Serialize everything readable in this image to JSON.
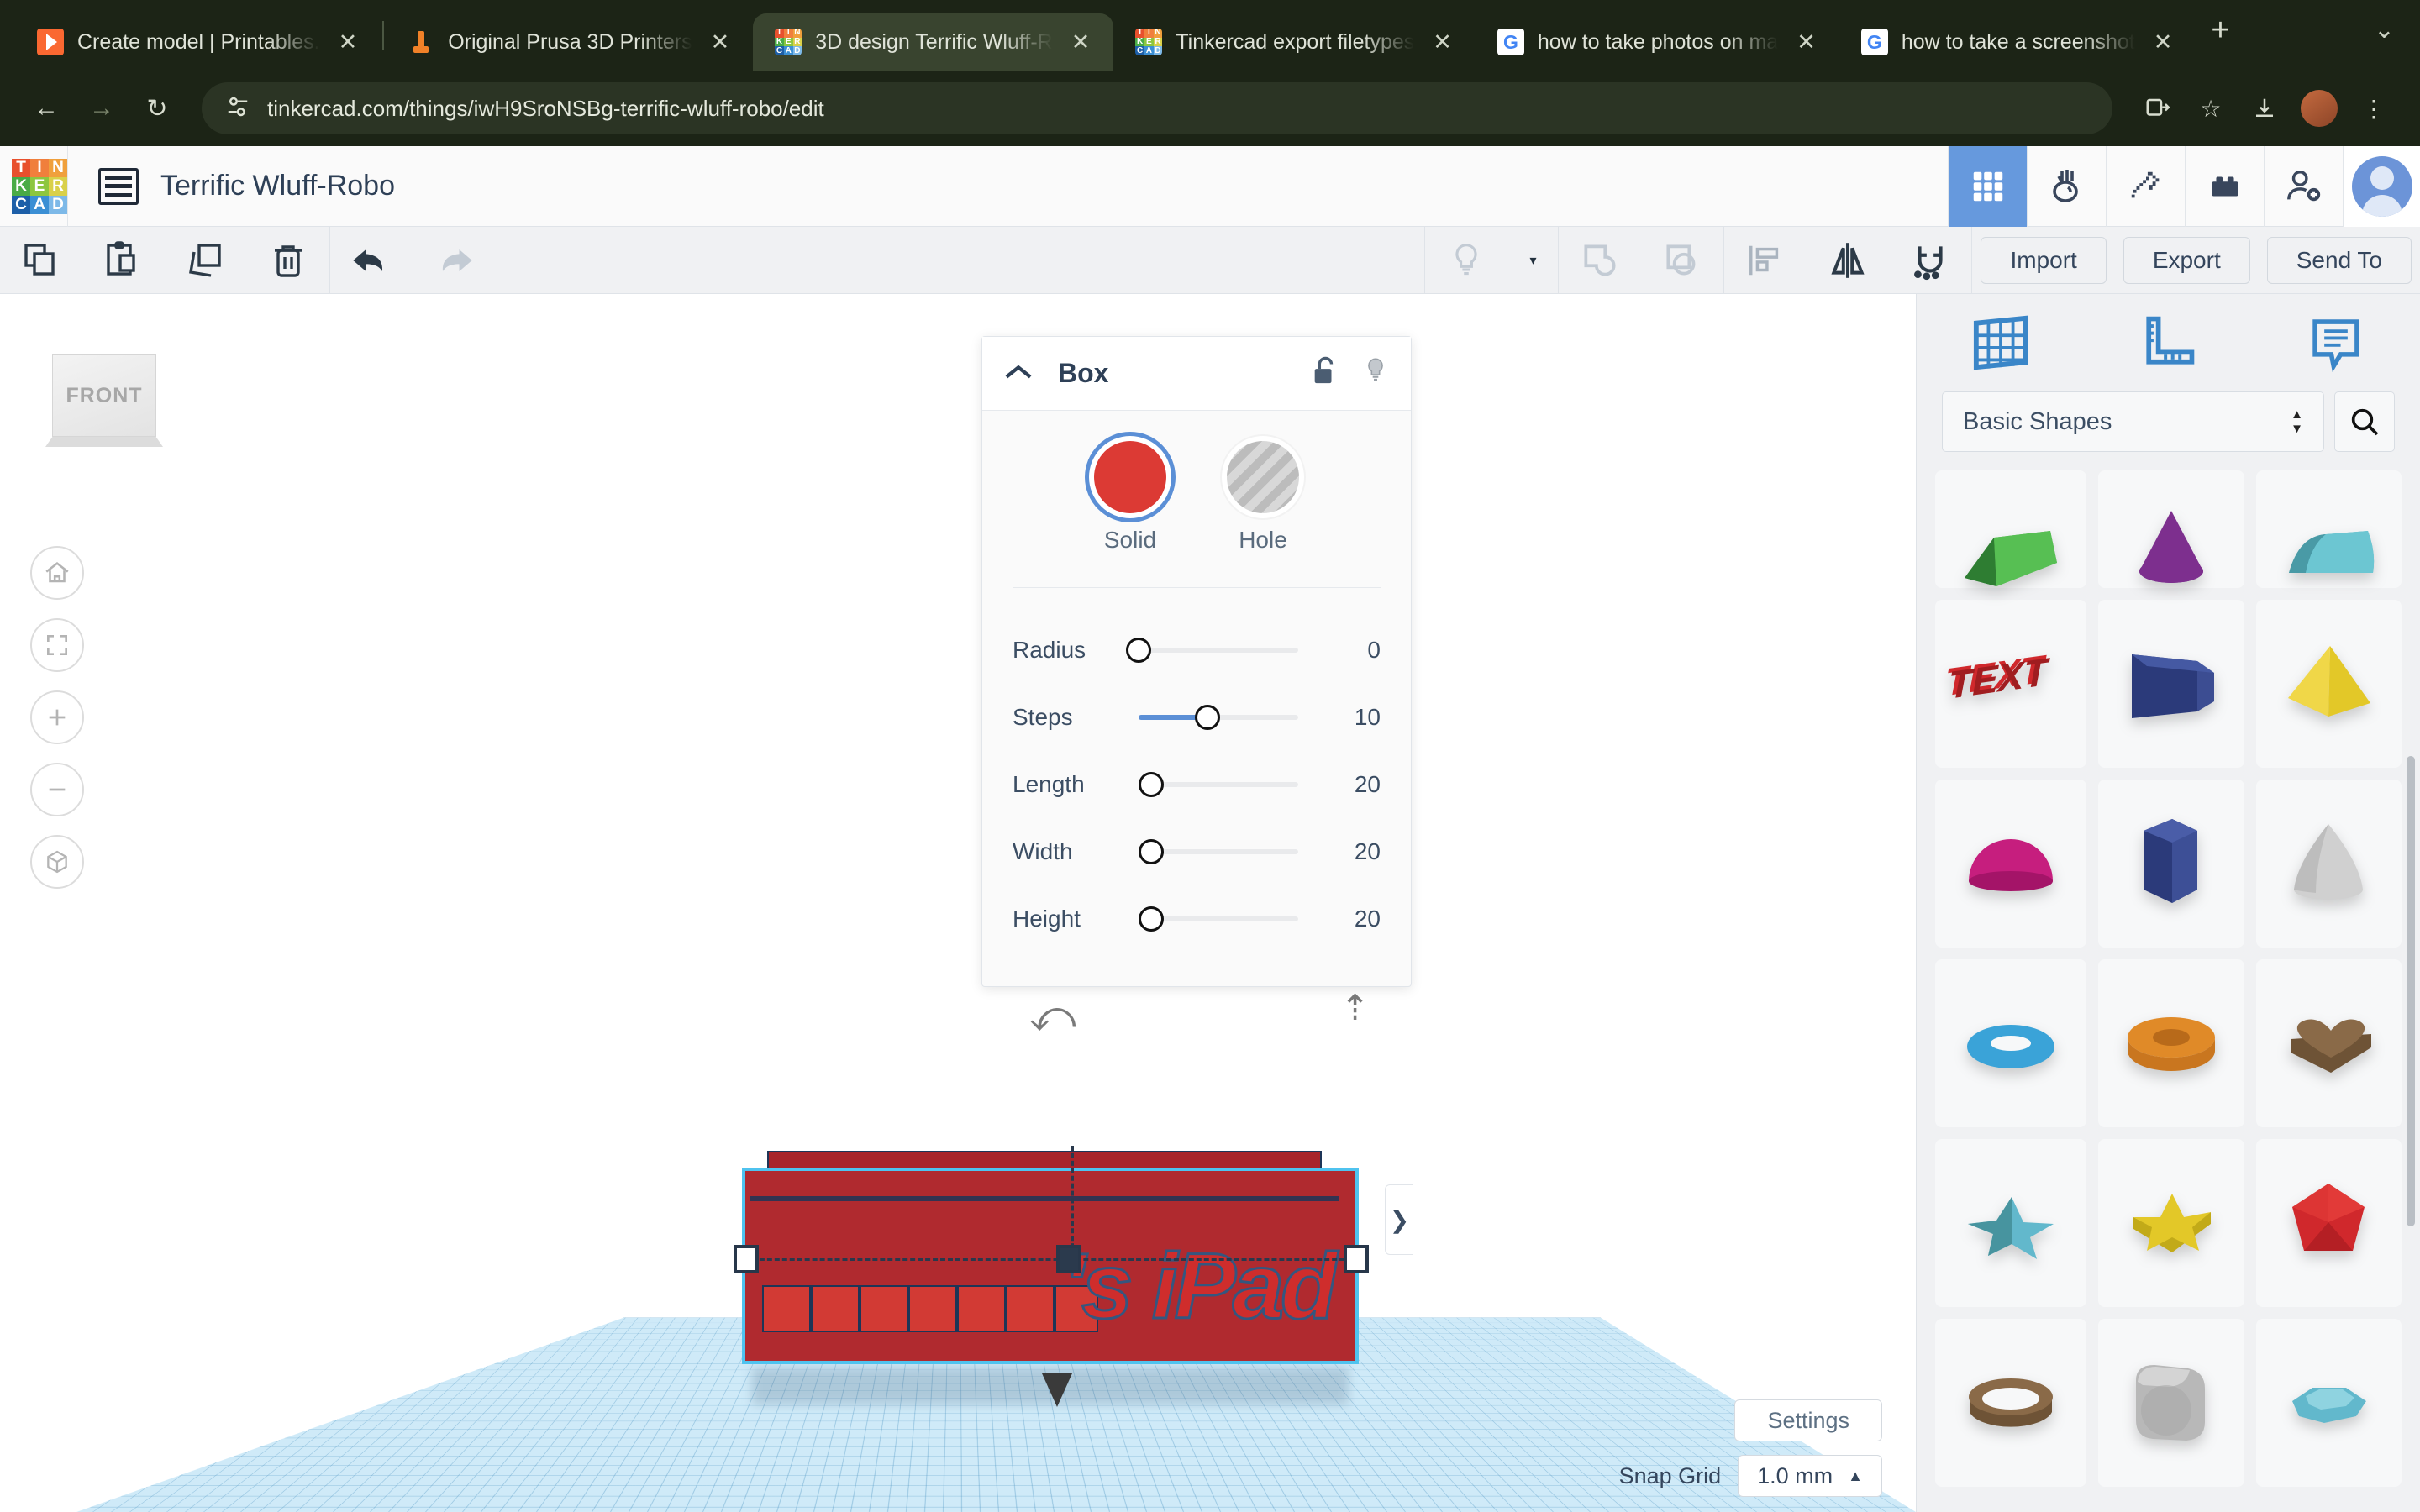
{
  "browser": {
    "tabs": [
      {
        "title": "Create model | Printables.",
        "favicon": "printables-icon",
        "active": false
      },
      {
        "title": "Original Prusa 3D Printers",
        "favicon": "prusa-icon",
        "active": false
      },
      {
        "title": "3D design Terrific Wluff-R",
        "favicon": "tinkercad-icon",
        "active": true
      },
      {
        "title": "Tinkercad export filetypes",
        "favicon": "tinkercad-icon",
        "active": false
      },
      {
        "title": "how to take photos on ma",
        "favicon": "google-icon",
        "active": false
      },
      {
        "title": "how to take a screenshot",
        "favicon": "google-icon",
        "active": false
      }
    ],
    "new_tab_label": "+",
    "tab_close_label": "✕",
    "tab_list_label": "⌄",
    "back_label": "←",
    "forward_label": "→",
    "reload_label": "↻",
    "url": "tinkercad.com/things/iwH9SroNSBg-terrific-wluff-robo/edit",
    "site_info_icon": "site-settings-icon",
    "install_icon": "install-app-icon",
    "bookmark_icon": "star-icon",
    "download_icon": "download-icon",
    "menu_icon": "kebab-menu-icon",
    "profile_icon": "profile-avatar-icon"
  },
  "tinkercad_logo": [
    "T",
    "I",
    "N",
    "K",
    "E",
    "R",
    "C",
    "A",
    "D"
  ],
  "header": {
    "menu_icon": "design-list-icon",
    "title": "Terrific Wluff-Robo",
    "tools": [
      {
        "name": "3d-designs-grid",
        "icon": "grid-icon",
        "active": true
      },
      {
        "name": "codeblocks",
        "icon": "codeblocks-hand-icon",
        "active": false
      },
      {
        "name": "minecraft",
        "icon": "pickaxe-icon",
        "active": false
      },
      {
        "name": "blocks",
        "icon": "lego-brick-icon",
        "active": false
      },
      {
        "name": "invite",
        "icon": "add-person-icon",
        "active": false
      }
    ],
    "avatar_icon": "user-avatar-icon"
  },
  "toolbar": {
    "left": [
      {
        "name": "copy",
        "icon": "copy-icon",
        "disabled": false
      },
      {
        "name": "paste",
        "icon": "paste-icon",
        "disabled": false
      },
      {
        "name": "duplicate",
        "icon": "duplicate-icon",
        "disabled": false
      },
      {
        "name": "delete",
        "icon": "trash-icon",
        "disabled": false
      }
    ],
    "history": [
      {
        "name": "undo",
        "icon": "undo-arrow-icon",
        "disabled": false
      },
      {
        "name": "redo",
        "icon": "redo-arrow-icon",
        "disabled": true
      }
    ],
    "right_icons": [
      {
        "name": "lightbulb",
        "icon": "lightbulb-icon",
        "disabled": true
      },
      {
        "name": "lightbulb-dropdown",
        "icon": "chevron-down-icon",
        "disabled": false
      },
      {
        "name": "group",
        "icon": "group-shapes-icon",
        "disabled": true
      },
      {
        "name": "ungroup",
        "icon": "ungroup-shapes-icon",
        "disabled": true
      },
      {
        "name": "align",
        "icon": "align-icon",
        "disabled": false
      },
      {
        "name": "mirror",
        "icon": "mirror-flip-icon",
        "disabled": false
      },
      {
        "name": "snap-magnet",
        "icon": "magnet-icon",
        "disabled": false
      }
    ],
    "import_label": "Import",
    "export_label": "Export",
    "send_to_label": "Send To"
  },
  "viewport": {
    "view_cube_label": "FRONT",
    "controls": [
      {
        "name": "home-view",
        "icon": "home-icon"
      },
      {
        "name": "fit-all",
        "icon": "fit-to-view-icon"
      },
      {
        "name": "zoom-in",
        "icon": "plus-icon"
      },
      {
        "name": "zoom-out",
        "icon": "minus-icon"
      },
      {
        "name": "ortho-toggle",
        "icon": "perspective-cube-icon"
      }
    ],
    "model_text": "'s iPad",
    "settings_label": "Settings",
    "snap_grid_label": "Snap Grid",
    "snap_grid_value": "1.0 mm",
    "snap_grid_caret": "▲"
  },
  "inspector": {
    "collapse_icon": "chevron-up-icon",
    "title": "Box",
    "lock_icon": "unlocked-padlock-icon",
    "light_icon": "lightbulb-icon",
    "modes": [
      {
        "label": "Solid",
        "color": "#dc3a34",
        "selected": true
      },
      {
        "label": "Hole",
        "color": "#bcbcbc",
        "selected": false
      }
    ],
    "sliders": [
      {
        "label": "Radius",
        "value": "0",
        "pct": 0
      },
      {
        "label": "Steps",
        "value": "10",
        "pct": 43
      },
      {
        "label": "Length",
        "value": "20",
        "pct": 8
      },
      {
        "label": "Width",
        "value": "20",
        "pct": 8
      },
      {
        "label": "Height",
        "value": "20",
        "pct": 8
      }
    ],
    "panel_toggle_icon": "chevron-right-icon"
  },
  "shapes_panel": {
    "tabs": [
      {
        "name": "workplane",
        "icon": "workplane-grid-icon"
      },
      {
        "name": "ruler",
        "icon": "ruler-icon"
      },
      {
        "name": "note",
        "icon": "note-callout-icon"
      }
    ],
    "category_value": "Basic Shapes",
    "search_icon": "search-icon",
    "shapes": [
      {
        "name": "roof",
        "icon": "roof-shape",
        "color": "#4aab46"
      },
      {
        "name": "cone",
        "icon": "cone-shape",
        "color": "#7d2f8e"
      },
      {
        "name": "half-cylinder",
        "icon": "half-cylinder-shape",
        "color": "#5bb8c4"
      },
      {
        "name": "text",
        "icon": "text-shape",
        "color": "#d0282c",
        "label": "TEXT"
      },
      {
        "name": "box",
        "icon": "box-shape",
        "color": "#2b3a7a"
      },
      {
        "name": "pyramid",
        "icon": "pyramid-shape",
        "color": "#e3c828"
      },
      {
        "name": "half-sphere",
        "icon": "half-sphere-shape",
        "color": "#c61e7e"
      },
      {
        "name": "hexagonal-prism",
        "icon": "hex-prism-shape",
        "color": "#2b3a7a"
      },
      {
        "name": "paraboloid",
        "icon": "paraboloid-shape",
        "color": "#c9c9c9"
      },
      {
        "name": "torus",
        "icon": "torus-shape",
        "color": "#3aa3d8"
      },
      {
        "name": "tube",
        "icon": "tube-shape",
        "color": "#e08a28"
      },
      {
        "name": "heart",
        "icon": "heart-shape",
        "color": "#8a6a48"
      },
      {
        "name": "star-3d",
        "icon": "star-3d-shape",
        "color": "#62b8cc"
      },
      {
        "name": "star-flat",
        "icon": "star-flat-shape",
        "color": "#e3c828"
      },
      {
        "name": "polygon-solid",
        "icon": "polyhedron-shape",
        "color": "#d0282c"
      },
      {
        "name": "ring",
        "icon": "ring-shape",
        "color": "#8a6a48"
      },
      {
        "name": "rounded-cube",
        "icon": "rounded-cube-shape",
        "color": "#b4b4b4"
      },
      {
        "name": "gem",
        "icon": "gem-shape",
        "color": "#62b8cc"
      }
    ]
  }
}
